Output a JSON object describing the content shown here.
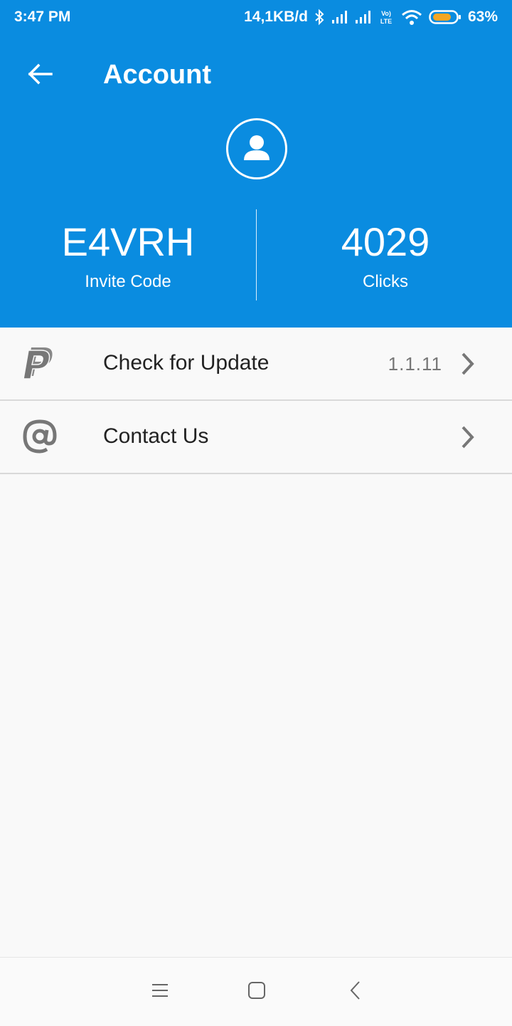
{
  "status_bar": {
    "time": "3:47 PM",
    "network_speed": "14,1KB/d",
    "battery": "63%",
    "icons": [
      "bluetooth-icon",
      "signal-icon",
      "signal-icon",
      "volte-icon",
      "wifi-icon",
      "battery-icon"
    ],
    "volte_top": "Vo)",
    "volte_bottom": "LTE"
  },
  "header": {
    "title": "Account",
    "background_color": "#0a8ce0",
    "invite_code": "E4VRH",
    "invite_label": "Invite Code",
    "clicks": "4029",
    "clicks_label": "Clicks"
  },
  "menu": {
    "items": [
      {
        "label": "Check for Update",
        "value": "1.1.11",
        "icon": "paypal-icon"
      },
      {
        "label": "Contact Us",
        "value": "",
        "icon": "at-sign-icon"
      }
    ]
  },
  "nav_bar": {
    "buttons": [
      "menu-icon",
      "home-icon",
      "back-icon"
    ]
  }
}
